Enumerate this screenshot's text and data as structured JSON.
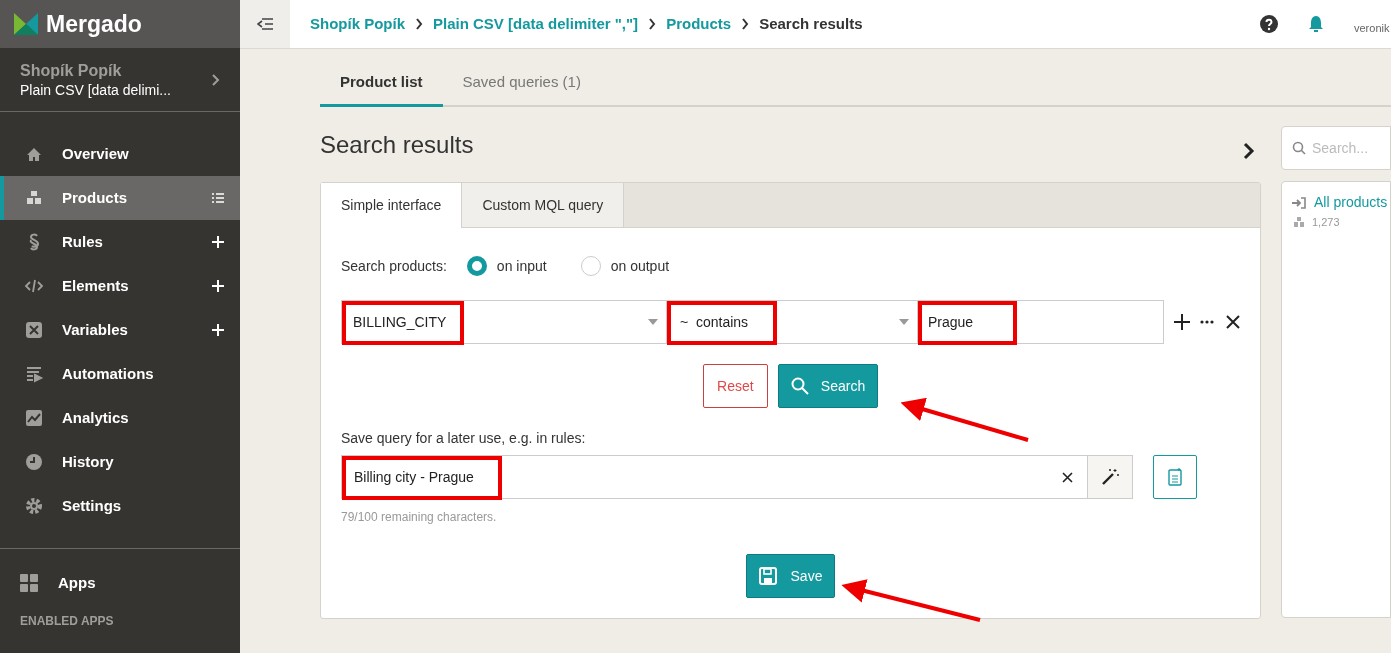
{
  "logo": {
    "text": "Mergado"
  },
  "project": {
    "name": "Shopík Popík",
    "feed": "Plain CSV [data delimi..."
  },
  "sidebar": {
    "items": [
      {
        "label": "Overview",
        "kind": "plain",
        "selected": false
      },
      {
        "label": "Products",
        "kind": "list",
        "selected": true
      },
      {
        "label": "Rules",
        "kind": "plus",
        "selected": false
      },
      {
        "label": "Elements",
        "kind": "plus",
        "selected": false
      },
      {
        "label": "Variables",
        "kind": "plus",
        "selected": false
      },
      {
        "label": "Automations",
        "kind": "plain",
        "selected": false
      },
      {
        "label": "Analytics",
        "kind": "plain",
        "selected": false
      },
      {
        "label": "History",
        "kind": "plain",
        "selected": false
      },
      {
        "label": "Settings",
        "kind": "plain",
        "selected": false
      }
    ],
    "apps": {
      "label": "Apps"
    },
    "section_label": "ENABLED APPS"
  },
  "breadcrumbs": [
    {
      "label": "Shopík Popík",
      "link": true
    },
    {
      "label": "Plain CSV [data delimiter \",\"]",
      "link": true
    },
    {
      "label": "Products",
      "link": true
    },
    {
      "label": "Search results",
      "link": false
    }
  ],
  "user": {
    "name": "veronik"
  },
  "tabs": [
    {
      "label": "Product list",
      "selected": true
    },
    {
      "label": "Saved queries (1)",
      "selected": false
    }
  ],
  "title": "Search results",
  "search_panel": {
    "placeholder": "Search...",
    "item": {
      "label": "All products",
      "count": "1,273"
    }
  },
  "card": {
    "tabs": [
      {
        "label": "Simple interface",
        "selected": true
      },
      {
        "label": "Custom MQL query",
        "selected": false
      }
    ],
    "search_on": {
      "label": "Search products:",
      "options": [
        {
          "label": "on input",
          "selected": true
        },
        {
          "label": "on output",
          "selected": false
        }
      ]
    },
    "condition": {
      "field": "BILLING_CITY",
      "operator": "~  contains",
      "value": "Prague"
    },
    "reset": "Reset",
    "search": "Search",
    "save_label": "Save query for a later use, e.g. in rules:",
    "query_name": "Billing city - Prague",
    "remaining": "79/100 remaining characters.",
    "save": "Save"
  }
}
